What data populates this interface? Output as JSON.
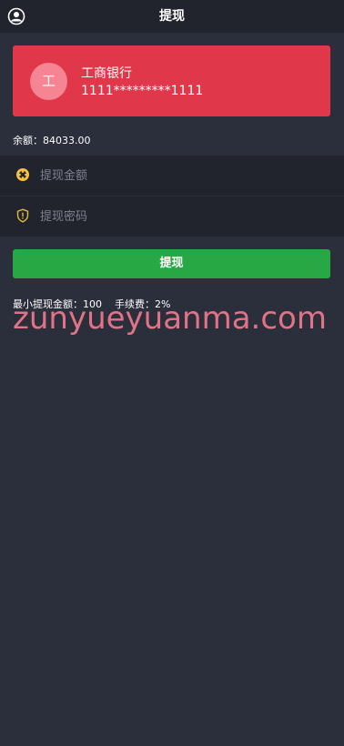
{
  "header": {
    "title": "提现",
    "user_icon": "user-circle-icon"
  },
  "bank_card": {
    "avatar_char": "工",
    "bank_name": "工商银行",
    "card_number": "1111*********1111",
    "color": "#e0374a"
  },
  "balance": {
    "text": "余额：84033.00"
  },
  "form": {
    "amount": {
      "icon": "coin-icon",
      "value": "",
      "placeholder": "提现金额"
    },
    "password": {
      "icon": "shield-alert-icon",
      "value": "",
      "placeholder": "提现密码"
    },
    "submit_label": "提现",
    "submit_color": "#28a745"
  },
  "info": {
    "min_amount": "最小提现金额：100",
    "fee": "手续费：2%"
  },
  "watermark": "zunyueyuanma.com"
}
